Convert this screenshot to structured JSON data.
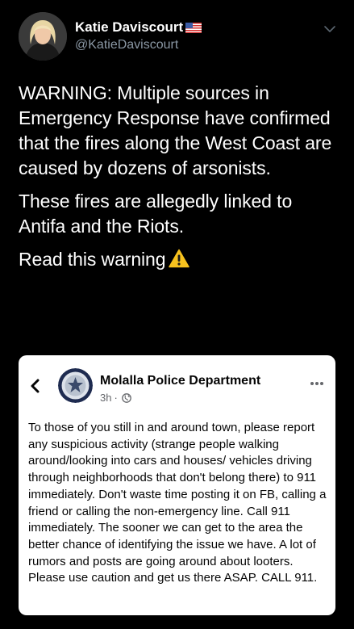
{
  "user": {
    "display_name": "Katie Daviscourt",
    "handle": "@KatieDaviscourt",
    "avatar_icon": "profile-photo",
    "badge_icon": "us-flag-icon"
  },
  "tweet": {
    "paragraph_1": "WARNING: Multiple sources in Emergency Response have confirmed that the fires along the West Coast are caused by dozens of arsonists.",
    "paragraph_2": "These fires are allegedly linked to Antifa and the Riots.",
    "paragraph_3": "Read this warning",
    "warning_icon": "warning-icon"
  },
  "embedded_post": {
    "page_name": "Molalla Police Department",
    "time": "3h",
    "separator": "·",
    "body": "To those of you still in and around town, please report any suspicious activity (strange people walking around/looking into cars and houses/ vehicles driving through neighborhoods that don't belong there) to 911 immediately.  Don't waste time posting it on FB, calling a friend or calling the non-emergency line.  Call 911 immediately.  The sooner we can get to the area the better chance of identifying the issue we have.  A lot of rumors and posts are going around about looters.  Please use caution and get us there ASAP.  CALL 911."
  },
  "colors": {
    "background": "#000000",
    "text_primary": "#ffffff",
    "text_secondary": "#8b98a5",
    "card_bg": "#ffffff",
    "card_meta": "#65676b"
  }
}
